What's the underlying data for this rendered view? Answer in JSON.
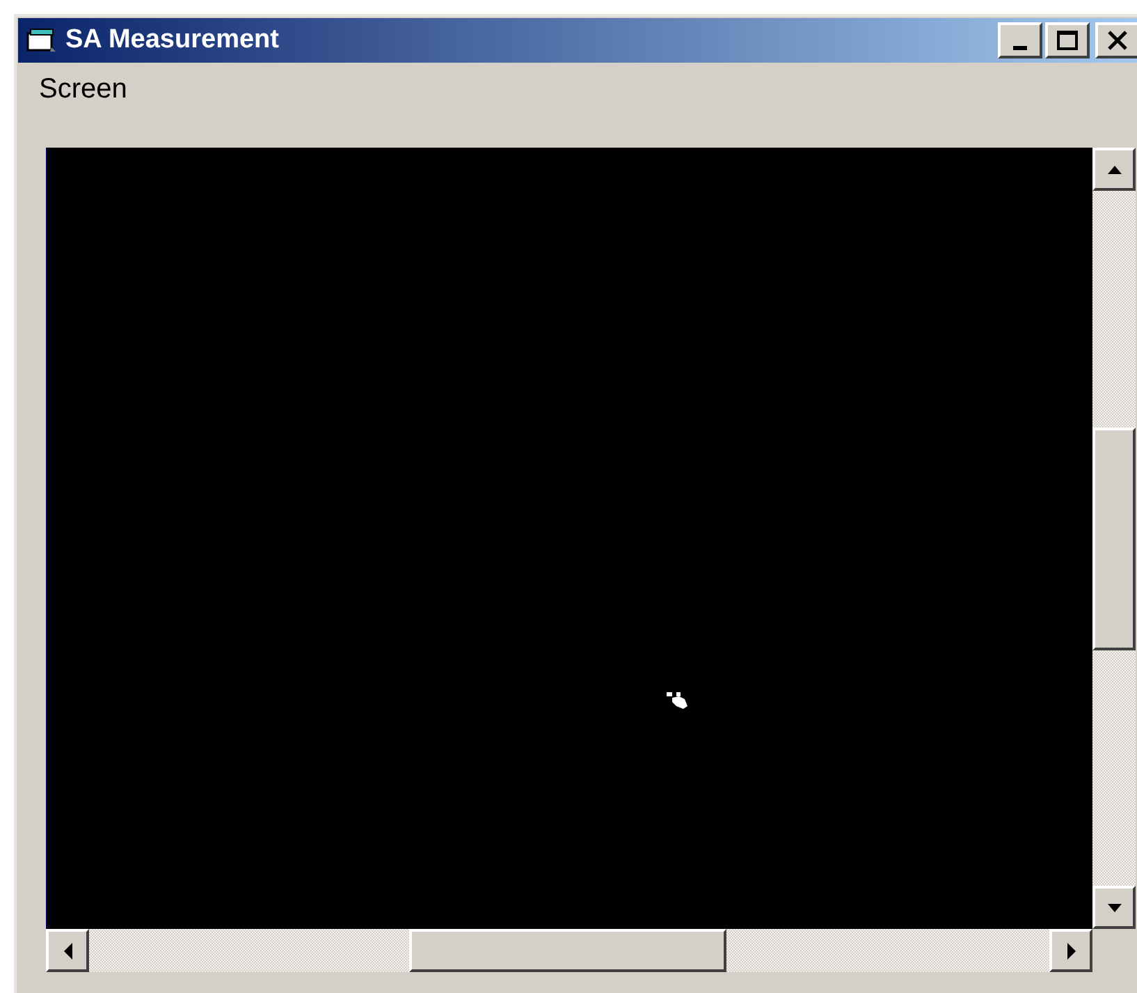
{
  "window": {
    "title": "SA Measurement"
  },
  "menu": [
    {
      "label": "Screen"
    }
  ]
}
